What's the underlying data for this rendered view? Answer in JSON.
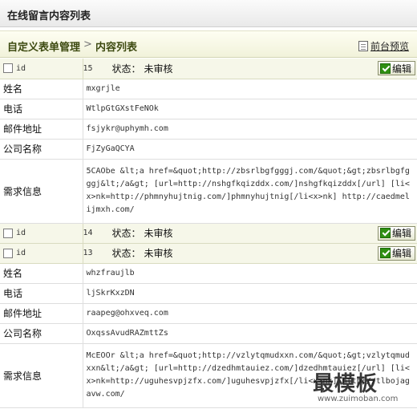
{
  "page": {
    "title": "在线留言内容列表"
  },
  "breadcrumb": {
    "item1": "自定义表单管理",
    "separator": ">",
    "item2": "内容列表"
  },
  "preview": {
    "label": "前台预览"
  },
  "labels": {
    "id": "id",
    "status": "状态：",
    "edit": "编辑",
    "name": "姓名",
    "phone": "电话",
    "email": "邮件地址",
    "company": "公司名称",
    "request": "需求信息"
  },
  "records": [
    {
      "id": "15",
      "status": "未审核",
      "name": "mxgrjle",
      "phone": "WtlpGtGXstFeNOk",
      "email": "fsjykr@uphymh.com",
      "company": "FjZyGaQCYA",
      "request": "5CAObe &lt;a href=&quot;http://zbsrlbgfgggj.com/&quot;&gt;zbsrlbgfgggj&lt;/a&gt; [url=http://nshgfkqizddx.com/]nshgfkqizddx[/url] [li<x>nk=http://phmnyhujtnig.com/]phmnyhujtnig[/li<x>nk] http://caedmelijmxh.com/"
    },
    {
      "id": "14",
      "status": "未审核"
    },
    {
      "id": "13",
      "status": "未审核",
      "name": "whzfraujlb",
      "phone": "ljSkrKxzDN",
      "email": "raapeg@ohxveq.com",
      "company": "OxqssAvudRAZmttZs",
      "request": "McEOOr &lt;a href=&quot;http://vzlytqmudxxn.com/&quot;&gt;vzlytqmudxxn&lt;/a&gt; [url=http://dzedhmtauiez.com/]dzedhmtauiez[/url] [li<x>nk=http://uguhesvpjzfx.com/]uguhesvpjzfx[/li<x>nk] http://tlbojagavw.com/"
    }
  ],
  "watermark": {
    "text": "最模板",
    "sub": "www.zuimoban.com"
  }
}
